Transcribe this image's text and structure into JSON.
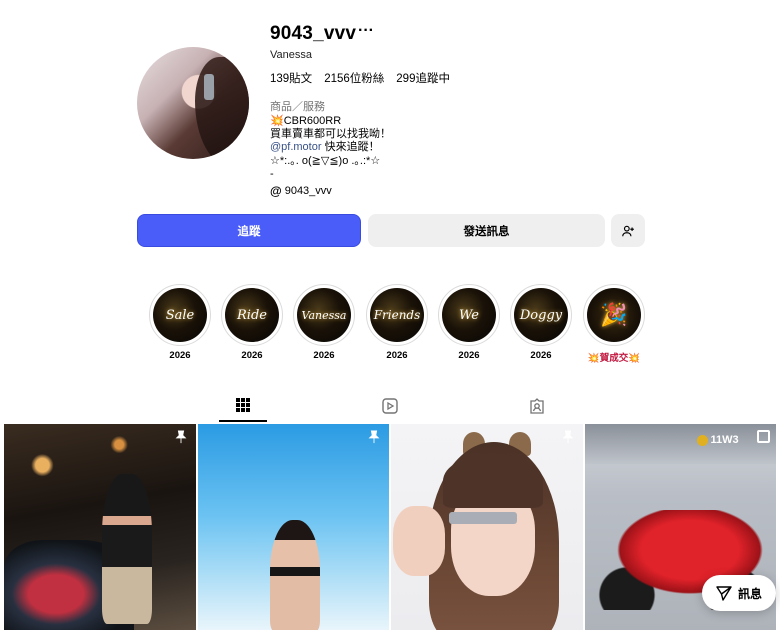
{
  "profile": {
    "username": "9043_vvv",
    "more": "···",
    "fullname": "Vanessa",
    "stats": {
      "posts": "139貼文",
      "followers": "2156位粉絲",
      "following": "299追蹤中"
    },
    "category": "商品／服務",
    "bio": {
      "line1": "💥CBR600RR",
      "line2": "買車賣車都可以找我呦！",
      "mention": "@pf.motor",
      "mention_suffix": " 快來追蹤！",
      "line4": "☆*:.｡. o(≧▽≦)o .｡.:*☆",
      "line5": "-"
    },
    "threads_icon": "@",
    "threads_handle": "9043_vvv"
  },
  "actions": {
    "follow": "追蹤",
    "message": "發送訊息",
    "add_user_icon": "person-add-icon"
  },
  "highlights": [
    {
      "title": "Sale",
      "caption": "2026"
    },
    {
      "title": "Ride",
      "caption": "2026"
    },
    {
      "title": "Vanessa",
      "caption": "2026"
    },
    {
      "title": "Friends",
      "caption": "2026"
    },
    {
      "title": "We",
      "caption": "2026"
    },
    {
      "title": "Doggy",
      "caption": "2026"
    },
    {
      "title": "🎉",
      "caption": "💥賀成交💥"
    }
  ],
  "tabs": [
    {
      "icon": "grid-icon",
      "active": true
    },
    {
      "icon": "reels-icon",
      "active": false
    },
    {
      "icon": "tagged-icon",
      "active": false
    }
  ],
  "posts": {
    "p4_tag": "11W3"
  },
  "fab": {
    "label": "訊息",
    "icon": "send-icon"
  },
  "colors": {
    "accent": "#4a5df9",
    "link": "#385185"
  }
}
